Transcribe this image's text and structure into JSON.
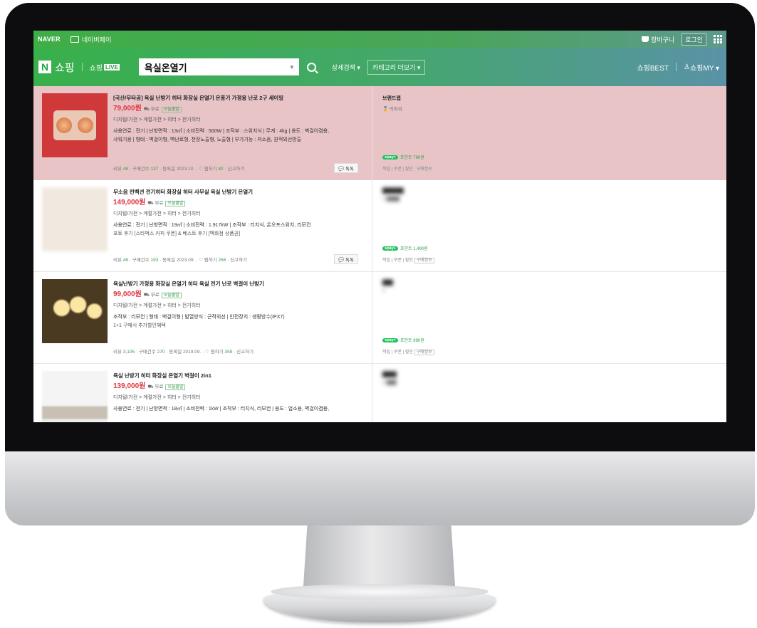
{
  "topbar": {
    "brand": "NAVER",
    "pay_label": "네이버페이",
    "cart_label": "장바구니",
    "login_label": "로그인"
  },
  "header": {
    "shopping_label": "쇼핑",
    "live_prefix": "쇼핑",
    "live_badge": "LIVE",
    "search_query": "욕실온열기",
    "advanced_search": "상세검색 ▾",
    "category_more": "카테고리 더보기 ▾",
    "best_label": "쇼핑BEST",
    "my_label": "쇼핑MY ▾"
  },
  "colors": {
    "accent_green": "#2a9f4b",
    "price_red": "#e0363f",
    "ad_highlight": "#e8c4c7"
  },
  "items": [
    {
      "title": "[국산/무타공] 욕실 난방기 히터 화장실 온열기 온풍기 가정용 난로 2구 세이핑",
      "price": "79,000원",
      "shipping": "무료",
      "badge": "오늘출발",
      "category": "디지털/가전 > 계절가전 > 히터 > 전기히터",
      "specs": "사용연료 : 전기 | 난방면적 : 13㎡ | 소비전력 : 500W | 조작부 : 스위치식 | 무게 : 4kg | 용도 : 벽걸이겸용,",
      "extra": "샤워기용 | 형태 : 벽걸이형, 벽난로형, 천장노출형, 노출형 | 부가기능 : 저소음, 원적외선방출",
      "meta": {
        "review_label": "리뷰",
        "reviews": "48",
        "purchase_label": "구매건수",
        "purchases": "137",
        "reg_label": "등록일",
        "reg_date": "2023.10.",
        "zzim_label": "찜하기",
        "zzim": "82",
        "report_label": "신고하기"
      },
      "chat_label": "톡톡",
      "mall_name": "브랜드랩",
      "mall_grade": "빅파워",
      "point": "포인트 790원",
      "benefits": "적립 | 쿠폰 | 할인",
      "buy_info": "구매정보"
    },
    {
      "title": "무소음 컨벡션 전기히터 화장실 히터 사무실 욕실 난방기 온열기",
      "price": "149,000원",
      "shipping": "무료",
      "badge": "오늘출발",
      "category": "디지털/가전 > 계절가전 > 히터 > 전기히터",
      "specs": "사용연료 : 전기 | 난방면적 : 19㎡ | 소비전력 : 1.917kW | 조작부 : 터치식, 온오프스위치, 리모컨",
      "extra": "포토 후기 [스타벅스 커피 쿠폰] & 베스트 후기 [백화점 상품권]",
      "meta": {
        "review_label": "리뷰",
        "reviews": "46",
        "purchase_label": "구매건수",
        "purchases": "193",
        "reg_label": "등록일",
        "reg_date": "2023.09.",
        "zzim_label": "찜하기",
        "zzim": "256",
        "report_label": "신고하기"
      },
      "chat_label": "톡톡",
      "mall_name": "",
      "mall_grade": "",
      "point": "포인트 1,490원",
      "benefits": "적립 | 쿠폰 | 할인",
      "buy_info": "구매정보"
    },
    {
      "title": "욕실난방기 가정용 화장실 온열기 히터 욕실 전기 난로 벽걸이 난방기",
      "price": "99,000원",
      "shipping": "무료",
      "badge": "오늘출발",
      "category": "디지털/가전 > 계절가전 > 히터 > 전기히터",
      "specs": "조작부 : 리모컨 | 형태 : 벽걸이형 | 발열방식 : 근적외선 | 안전장치 : 생활방수(IPX7)",
      "extra": "1+1 구매시 추가할인혜택",
      "meta": {
        "review_label": "리뷰",
        "reviews": "3,105",
        "purchase_label": "구매건수",
        "purchases": "270",
        "reg_label": "등록일",
        "reg_date": "2019.09.",
        "zzim_label": "찜하기",
        "zzim": "359",
        "report_label": "신고하기"
      },
      "chat_label": "",
      "mall_name": "",
      "mall_grade": "",
      "point": "포인트 990원",
      "benefits": "적립 | 쿠폰 | 할인",
      "buy_info": "구매정보"
    },
    {
      "title": "욕실 난방기 히터 화장실 온열기 벽걸이 2in1",
      "price": "139,000원",
      "shipping": "무료",
      "badge": "오늘출발",
      "category": "디지털/가전 > 계절가전 > 히터 > 전기히터",
      "specs": "사용연료 : 전기 | 난방면적 : 18㎡ | 소비전력 : 1kW | 조작부 : 터치식, 리모컨 | 용도 : 업소용, 벽걸이겸용,",
      "extra": "",
      "meta": {
        "review_label": "",
        "reviews": "",
        "purchase_label": "",
        "purchases": "",
        "reg_label": "",
        "reg_date": "",
        "zzim_label": "",
        "zzim": "",
        "report_label": ""
      },
      "chat_label": "",
      "mall_name": "",
      "mall_grade": "",
      "point": "",
      "benefits": "",
      "buy_info": ""
    }
  ]
}
